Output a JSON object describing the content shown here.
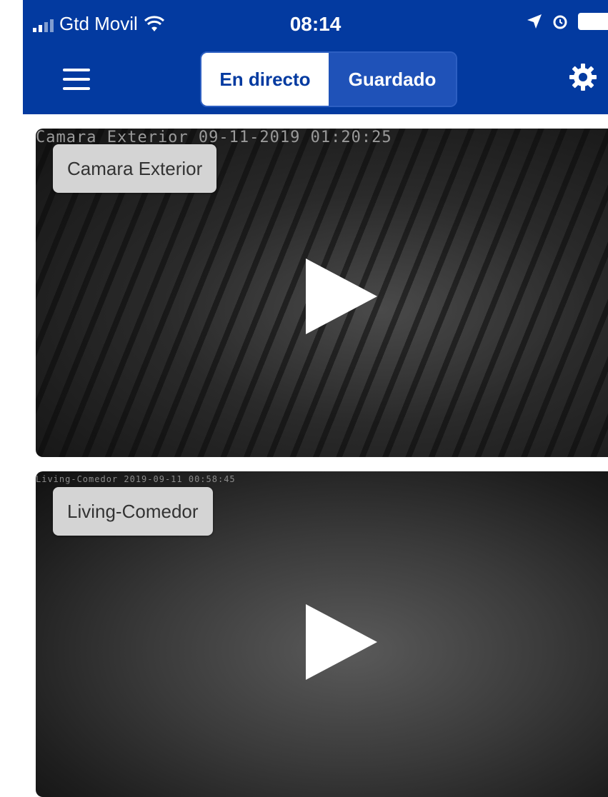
{
  "status_bar": {
    "carrier": "Gtd Movil",
    "time": "08:14"
  },
  "nav": {
    "tabs": [
      {
        "label": "En directo",
        "active": true
      },
      {
        "label": "Guardado",
        "active": false
      }
    ]
  },
  "cameras": [
    {
      "label": "Camara Exterior",
      "overlay": "Camara Exterior  09-11-2019 01:20:25"
    },
    {
      "label": "Living-Comedor",
      "overlay": "Living-Comedor 2019-09-11 00:58:45"
    }
  ],
  "icons": {
    "menu": "hamburger-menu-icon",
    "settings": "gear-icon",
    "play": "play-icon",
    "wifi": "wifi-icon",
    "location": "location-arrow-icon",
    "alarm": "alarm-icon",
    "battery": "battery-icon"
  },
  "colors": {
    "header_bg": "#033aa0",
    "active_tab_bg": "#ffffff",
    "inactive_tab_bg": "#1f52b8",
    "label_bg": "#d4d4d4"
  }
}
